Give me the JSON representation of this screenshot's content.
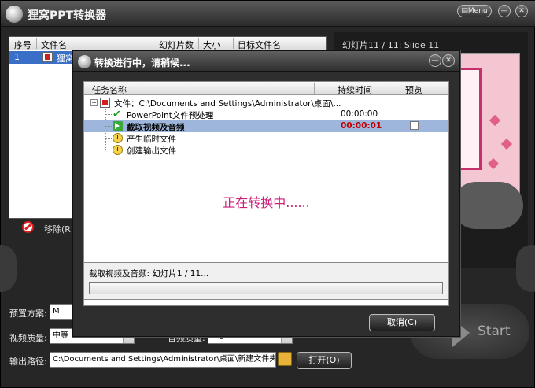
{
  "app": {
    "title": "狸窝PPT转换器",
    "menu_label": "Menu",
    "minimize_label": "—",
    "close_label": "✕"
  },
  "file_list": {
    "columns": [
      "序号",
      "文件名",
      "幻灯片数",
      "大小",
      "目标文件名"
    ],
    "rows": [
      {
        "index": "1",
        "name": "狸窝"
      }
    ],
    "remove_label": "移除(R)"
  },
  "preview": {
    "title": "幻灯片11 / 11: Slide 11"
  },
  "settings": {
    "preset_label": "预置方案:",
    "preset_value": "M",
    "quality_label": "视频质量:",
    "quality_value": "中等",
    "audio_quality_label": "音频质量:",
    "audio_quality_value": "High",
    "output_label": "输出路径:",
    "output_path": "C:\\Documents and Settings\\Administrator\\桌面\\新建文件夹",
    "open_label": "打开(O)",
    "start_label": "Start"
  },
  "dialog": {
    "title": "转换进行中，请稍候...",
    "columns": {
      "name": "任务名称",
      "duration": "持续时间",
      "preview": "预览"
    },
    "root_task": "文件：C:\\Documents and Settings\\Administrator\\桌面\\...",
    "tasks": [
      {
        "name": "PowerPoint文件预处理",
        "duration": "00:00:00",
        "status": "done"
      },
      {
        "name": "截取视频及音频",
        "duration": "00:00:01",
        "status": "active"
      },
      {
        "name": "产生临时文件",
        "duration": "",
        "status": "pending"
      },
      {
        "name": "创建输出文件",
        "duration": "",
        "status": "pending"
      }
    ],
    "converting_text": "正在转换中......",
    "status_text": "截取视频及音频: 幻灯片1 / 11...",
    "progress": 0.0,
    "cancel_label": "取消(C)"
  }
}
